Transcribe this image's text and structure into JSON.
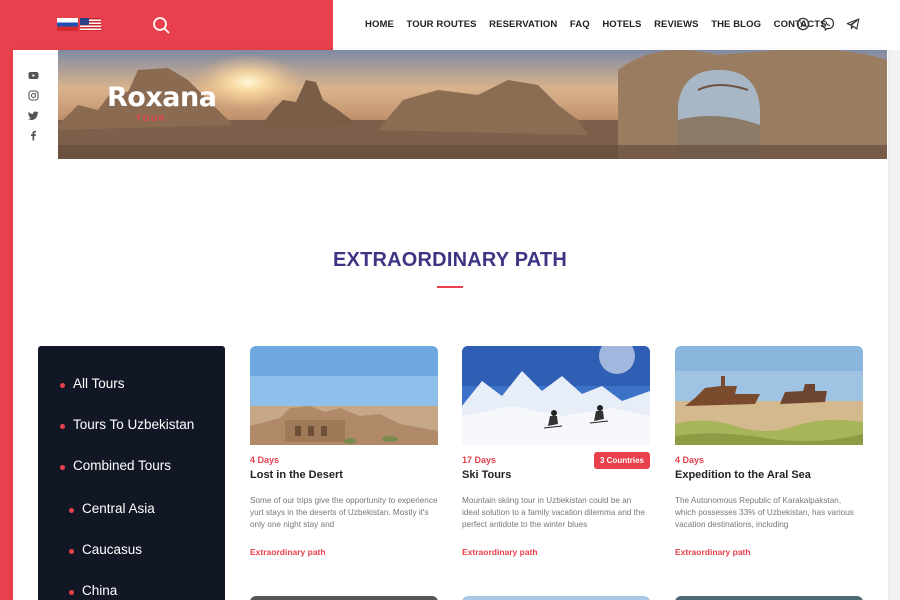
{
  "header": {
    "languages": [
      {
        "name": "Russian",
        "icon": "flag-ru-icon"
      },
      {
        "name": "English",
        "icon": "flag-us-icon"
      }
    ],
    "nav": [
      "HOME",
      "TOUR ROUTES",
      "RESERVATION",
      "FAQ",
      "HOTELS",
      "REVIEWS",
      "THE BLOG",
      "CONTACTS"
    ],
    "contact_icons": [
      "whatsapp-icon",
      "viber-icon",
      "telegram-icon"
    ]
  },
  "social": [
    "youtube-icon",
    "instagram-icon",
    "twitter-icon",
    "facebook-icon"
  ],
  "hero": {
    "logo": "Roxana",
    "logo_sub": "TOUR"
  },
  "section": {
    "title": "EXTRAORDINARY PATH"
  },
  "sidebar": {
    "items": [
      "All Tours",
      "Tours To Uzbekistan",
      "Combined Tours",
      "Central Asia",
      "Caucasus",
      "China"
    ]
  },
  "tours": [
    {
      "days": "4 Days",
      "name": "Lost in the Desert",
      "description": "Some of our trips give the opportunity to experience yurt stays in the deserts of Uzbekistan. Mostly it's only one night stay and",
      "link": "Extraordinary path"
    },
    {
      "days": "17 Days",
      "badge": "3 Countries",
      "name": "Ski Tours",
      "description": "Mountain skiing tour in Uzbekistan could be an ideal solution to a family vacation dilemma and the perfect antidote to the winter blues",
      "link": "Extraordinary path"
    },
    {
      "days": "4 Days",
      "name": "Expedition to the Aral Sea",
      "description": "The Autonomous Republic of Karakalpakstan, which possesses 33% of Uzbekistan, has various vacation destinations, including",
      "link": "Extraordinary path"
    }
  ],
  "colors": {
    "accent": "#e8404c",
    "title": "#3d3584",
    "sidebar_bg": "#121726"
  }
}
